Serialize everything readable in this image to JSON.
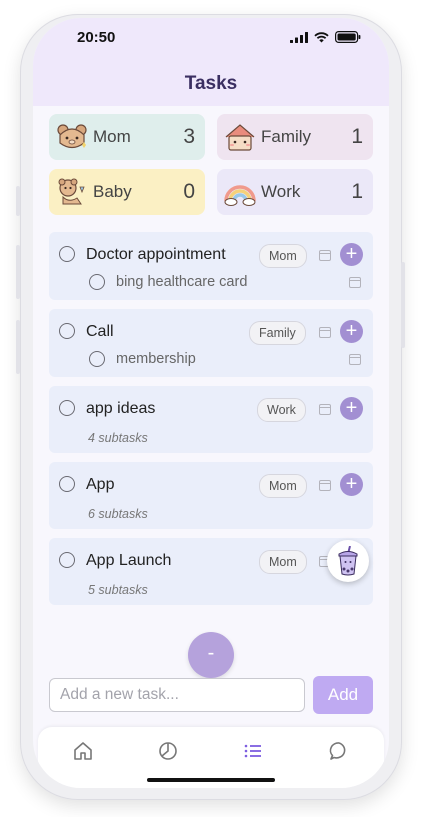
{
  "status": {
    "time": "20:50"
  },
  "header": {
    "title": "Tasks"
  },
  "categories": [
    {
      "name": "Mom",
      "count": "3",
      "bg": "#dfeeec",
      "icon": "bear-face-icon"
    },
    {
      "name": "Family",
      "count": "1",
      "bg": "#efe4f0",
      "icon": "house-icon"
    },
    {
      "name": "Baby",
      "count": "0",
      "bg": "#fbf0c4",
      "icon": "baby-bear-icon"
    },
    {
      "name": "Work",
      "count": "1",
      "bg": "#ebe8f8",
      "icon": "rainbow-icon"
    }
  ],
  "tasks": [
    {
      "title": "Doctor appointment",
      "tag": "Mom",
      "subtasks": [
        {
          "title": "bing healthcare card"
        }
      ]
    },
    {
      "title": "Call",
      "tag": "Family",
      "subtasks": [
        {
          "title": "membership"
        }
      ]
    },
    {
      "title": "app ideas",
      "tag": "Work",
      "subtask_count": "4 subtasks"
    },
    {
      "title": "App",
      "tag": "Mom",
      "subtask_count": "6 subtasks"
    },
    {
      "title": "App Launch",
      "tag": "Mom",
      "subtask_count": "5 subtasks"
    }
  ],
  "fab_label": "-",
  "input": {
    "placeholder": "Add a new task...",
    "value": ""
  },
  "add_label": "Add",
  "plus_label": "+",
  "tabs": [
    "home-icon",
    "stats-icon",
    "list-icon",
    "chat-icon"
  ],
  "colors": {
    "accent": "#a28fd2",
    "header_bg": "#efe8fb",
    "task_bg": "#eaeefa",
    "add_button": "#bfaaf2"
  }
}
